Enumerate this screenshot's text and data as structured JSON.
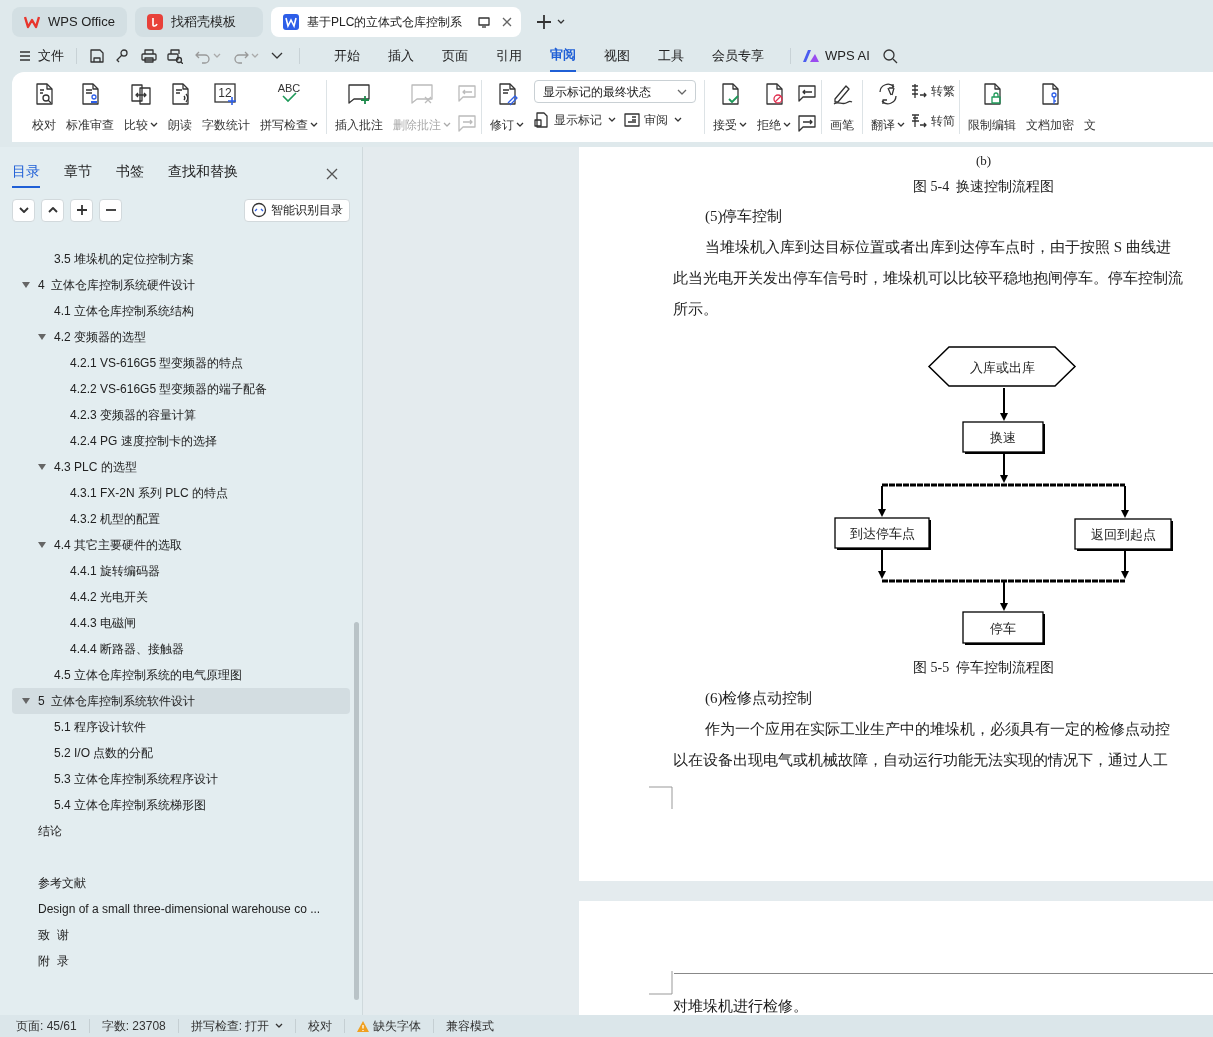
{
  "tabs": [
    {
      "label": "WPS Office",
      "kind": "wps",
      "selected": false
    },
    {
      "label": "找稻壳模板",
      "kind": "docer",
      "selected": false
    },
    {
      "label": "基于PLC的立体式仓库控制系",
      "kind": "doc",
      "selected": true
    }
  ],
  "file_menu": "文件",
  "menu": [
    {
      "label": "开始",
      "selected": false
    },
    {
      "label": "插入",
      "selected": false
    },
    {
      "label": "页面",
      "selected": false
    },
    {
      "label": "引用",
      "selected": false
    },
    {
      "label": "审阅",
      "selected": true
    },
    {
      "label": "视图",
      "selected": false
    },
    {
      "label": "工具",
      "selected": false
    },
    {
      "label": "会员专享",
      "selected": false
    }
  ],
  "ai_label": "WPS AI",
  "ribbon": [
    [
      {
        "kind": "big",
        "label": "校对",
        "dropdown": false,
        "disabled": false
      },
      {
        "kind": "big",
        "label": "标准审查",
        "dropdown": false,
        "disabled": false
      },
      {
        "kind": "big",
        "label": "比较",
        "dropdown": true,
        "disabled": false
      },
      {
        "kind": "big",
        "label": "朗读",
        "dropdown": false,
        "disabled": false
      },
      {
        "kind": "big",
        "label": "字数统计",
        "dropdown": false,
        "disabled": false,
        "icon_text": "12"
      },
      {
        "kind": "big",
        "label": "拼写检查",
        "dropdown": true,
        "disabled": false,
        "icon_text": "ABC"
      }
    ],
    [
      {
        "kind": "big",
        "label": "插入批注",
        "dropdown": false,
        "disabled": false
      },
      {
        "kind": "big",
        "label": "删除批注",
        "dropdown": true,
        "disabled": true
      },
      {
        "kind": "icon_pair",
        "disabled": true
      }
    ],
    [
      {
        "kind": "big",
        "label": "修订",
        "dropdown": true,
        "disabled": false
      },
      {
        "kind": "select",
        "value": "显示标记的最终状态"
      },
      {
        "kind": "small",
        "label": "显示标记",
        "dropdown": true,
        "disabled": false
      },
      {
        "kind": "small",
        "label": "审阅",
        "dropdown": true,
        "disabled": false
      }
    ],
    [
      {
        "kind": "big",
        "label": "接受",
        "dropdown": true,
        "disabled": false
      },
      {
        "kind": "big",
        "label": "拒绝",
        "dropdown": true,
        "disabled": false
      },
      {
        "kind": "icon_pair",
        "disabled": false
      }
    ],
    [
      {
        "kind": "big",
        "label": "画笔",
        "dropdown": false,
        "disabled": false
      }
    ],
    [
      {
        "kind": "big",
        "label": "翻译",
        "dropdown": true,
        "disabled": false
      },
      {
        "kind": "small",
        "label": "转繁",
        "dropdown": false,
        "disabled": false
      },
      {
        "kind": "small",
        "label": "转简",
        "dropdown": false,
        "disabled": false
      }
    ],
    [
      {
        "kind": "big",
        "label": "限制编辑",
        "dropdown": false,
        "disabled": false
      },
      {
        "kind": "big",
        "label": "文档加密",
        "dropdown": false,
        "disabled": false
      },
      {
        "kind": "big",
        "label": "文",
        "dropdown": false,
        "disabled": false
      }
    ]
  ],
  "sidebar": {
    "tabs": [
      {
        "label": "目录",
        "selected": true
      },
      {
        "label": "章节",
        "selected": false
      },
      {
        "label": "书签",
        "selected": false
      },
      {
        "label": "查找和替换",
        "selected": false
      }
    ],
    "smart_button": "智能识别目录",
    "continued_items": [
      {
        "label": "3.5 堆垛机的定位控制方案",
        "selected": false
      }
    ],
    "toc": [
      {
        "label": "4  立体仓库控制系统硬件设计",
        "selected": false,
        "expanded": true,
        "children": [
          {
            "label": "4.1 立体仓库控制系统结构",
            "selected": false
          },
          {
            "label": "4.2 变频器的选型",
            "selected": false,
            "expanded": true,
            "children": [
              {
                "label": "4.2.1 VS-616G5 型变频器的特点",
                "selected": false
              },
              {
                "label": "4.2.2 VS-616G5 型变频器的端子配备",
                "selected": false
              },
              {
                "label": "4.2.3 变频器的容量计算",
                "selected": false
              },
              {
                "label": "4.2.4 PG 速度控制卡的选择",
                "selected": false
              }
            ]
          },
          {
            "label": "4.3 PLC 的选型",
            "selected": false,
            "expanded": true,
            "children": [
              {
                "label": "4.3.1 FX-2N 系列 PLC 的特点",
                "selected": false
              },
              {
                "label": "4.3.2 机型的配置",
                "selected": false
              }
            ]
          },
          {
            "label": "4.4 其它主要硬件的选取",
            "selected": false,
            "expanded": true,
            "children": [
              {
                "label": "4.4.1 旋转编码器",
                "selected": false
              },
              {
                "label": "4.4.2 光电开关",
                "selected": false
              },
              {
                "label": "4.4.3 电磁闸",
                "selected": false
              },
              {
                "label": "4.4.4 断路器、接触器",
                "selected": false
              }
            ]
          },
          {
            "label": "4.5 立体仓库控制系统的电气原理图",
            "selected": false
          }
        ]
      },
      {
        "label": "5  立体仓库控制系统软件设计",
        "selected": true,
        "expanded": true,
        "children": [
          {
            "label": "5.1 程序设计软件",
            "selected": false
          },
          {
            "label": "5.2 I/O 点数的分配",
            "selected": false
          },
          {
            "label": "5.3 立体仓库控制系统程序设计",
            "selected": false
          },
          {
            "label": "5.4 立体仓库控制系统梯形图",
            "selected": false
          }
        ]
      },
      {
        "label": "结论",
        "selected": false
      },
      {
        "label": "参考文献",
        "selected": false,
        "spaced": true
      },
      {
        "label": "Design of a small three-dimensional warehouse co ...",
        "selected": false
      },
      {
        "label": "致  谢",
        "selected": false
      },
      {
        "label": "附  录",
        "selected": false
      }
    ]
  },
  "page1": {
    "subfigure": "(b)",
    "caption_top": "图 5-4  换速控制流程图",
    "blocks_top": [
      {
        "kind": "heading",
        "text": "(5)停车控制"
      },
      {
        "kind": "first_line",
        "text": "当堆垛机入库到达目标位置或者出库到达停车点时，由于按照 S 曲线进"
      },
      {
        "kind": "line",
        "text": "此当光电开关发出停车信号时，堆垛机可以比较平稳地抱闸停车。停车控制流"
      },
      {
        "kind": "line",
        "text": "所示。"
      }
    ],
    "flowchart": {
      "nodes": [
        {
          "label": "入库或出库",
          "kind": "terminal"
        },
        {
          "label": "换速",
          "kind": "process"
        },
        {
          "label": "到达停车点",
          "kind": "process"
        },
        {
          "label": "返回到起点",
          "kind": "process"
        },
        {
          "label": "停车",
          "kind": "process"
        }
      ]
    },
    "caption": "图 5-5  停车控制流程图",
    "blocks_bottom": [
      {
        "kind": "heading",
        "text": "(6)检修点动控制"
      },
      {
        "kind": "first_line",
        "text": "作为一个应用在实际工业生产中的堆垛机，必须具有一定的检修点动控"
      },
      {
        "kind": "line",
        "text": "以在设备出现电气或机械故障，自动运行功能无法实现的情况下，通过人工"
      }
    ]
  },
  "page2": {
    "text": "对堆垛机进行检修。"
  },
  "status_bar": [
    {
      "label": "页面: 45/61",
      "kind": "text"
    },
    {
      "label": "字数: 23708",
      "kind": "text"
    },
    {
      "label": "拼写检查: 打开",
      "kind": "dropdown"
    },
    {
      "label": "校对",
      "kind": "text"
    },
    {
      "label": "缺失字体",
      "kind": "warning"
    },
    {
      "label": "兼容模式",
      "kind": "text"
    }
  ]
}
